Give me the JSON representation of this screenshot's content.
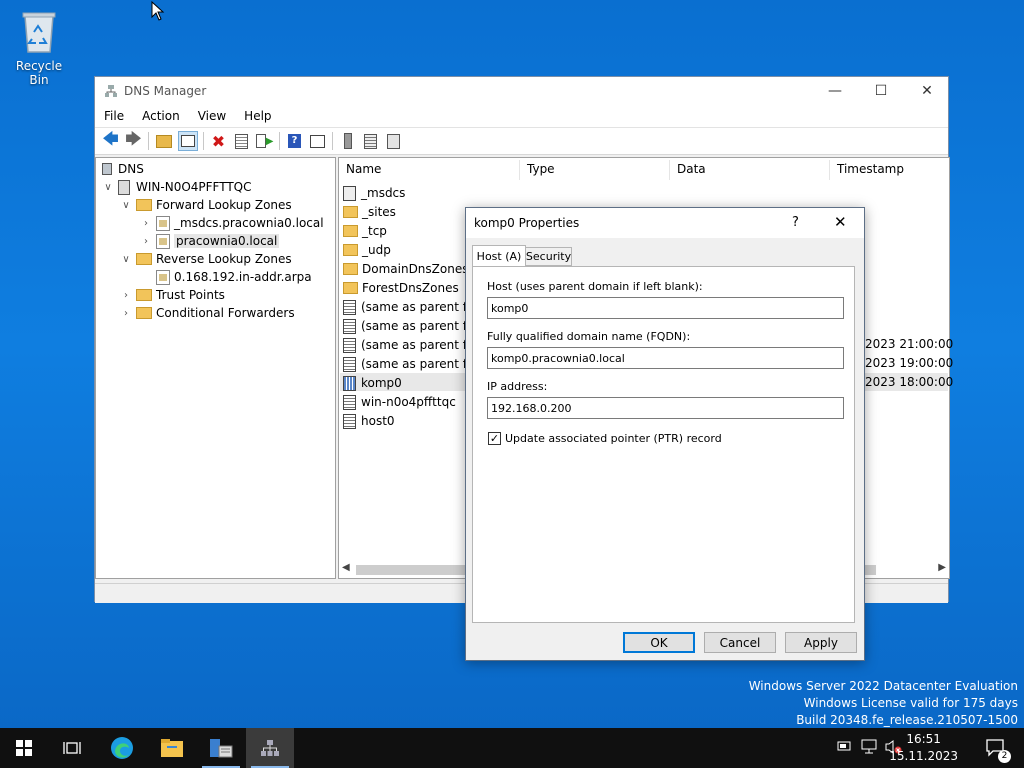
{
  "desktop": {
    "recycle_bin": "Recycle Bin",
    "watermark": {
      "line1": "Windows Server 2022 Datacenter Evaluation",
      "line2": "Windows License valid for 175 days",
      "line3": "Build 20348.fe_release.210507-1500"
    }
  },
  "window": {
    "title": "DNS Manager",
    "menu": [
      "File",
      "Action",
      "View",
      "Help"
    ]
  },
  "tree": {
    "root": "DNS",
    "server": "WIN-N0O4PFFTTQC",
    "forward_zones": "Forward Lookup Zones",
    "fz1": "_msdcs.pracownia0.local",
    "fz2": "pracownia0.local",
    "reverse_zones": "Reverse Lookup Zones",
    "rz1": "0.168.192.in-addr.arpa",
    "trust_points": "Trust Points",
    "conditional_forwarders": "Conditional Forwarders"
  },
  "list": {
    "columns": [
      "Name",
      "Type",
      "Data",
      "Timestamp"
    ],
    "rows": [
      {
        "name": "_msdcs"
      },
      {
        "name": "_sites"
      },
      {
        "name": "_tcp"
      },
      {
        "name": "_udp"
      },
      {
        "name": "DomainDnsZones"
      },
      {
        "name": "ForestDnsZones"
      },
      {
        "name": "(same as parent fold"
      },
      {
        "name": "(same as parent fold"
      },
      {
        "name": "(same as parent fold"
      },
      {
        "name": "(same as parent fold"
      },
      {
        "name": "komp0"
      },
      {
        "name": "win-n0o4pffttqc"
      },
      {
        "name": "host0"
      }
    ],
    "timestamps": [
      "2023 21:00:00",
      "2023 19:00:00",
      "2023 18:00:00"
    ]
  },
  "dialog": {
    "title": "komp0 Properties",
    "help": "?",
    "tabs": [
      "Host (A)",
      "Security"
    ],
    "host_label": "Host (uses parent domain if left blank):",
    "host_value": "komp0",
    "fqdn_label": "Fully qualified domain name (FQDN):",
    "fqdn_value": "komp0.pracownia0.local",
    "ip_label": "IP address:",
    "ip_value": "192.168.0.200",
    "ptr_label": "Update associated pointer (PTR) record",
    "ptr_checked": true,
    "ok": "OK",
    "cancel": "Cancel",
    "apply": "Apply"
  },
  "taskbar": {
    "time": "16:51",
    "date": "15.11.2023",
    "notification_count": "2"
  }
}
